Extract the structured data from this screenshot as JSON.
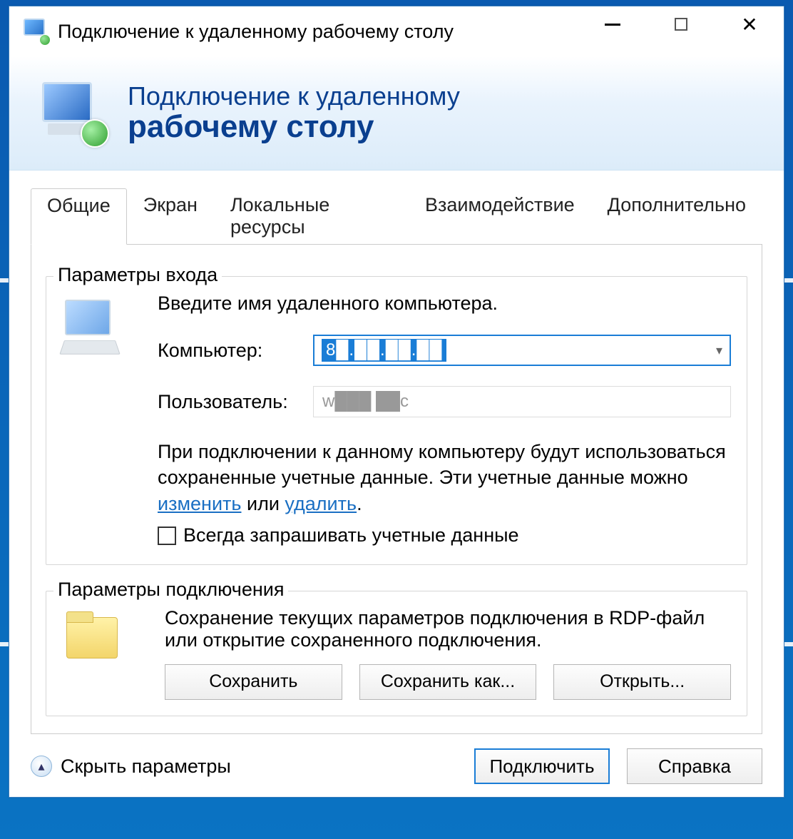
{
  "titlebar": {
    "title": "Подключение к удаленному рабочему столу"
  },
  "banner": {
    "line1": "Подключение к удаленному",
    "line2": "рабочему столу"
  },
  "tabs": [
    "Общие",
    "Экран",
    "Локальные ресурсы",
    "Взаимодействие",
    "Дополнительно"
  ],
  "login_group": {
    "legend": "Параметры входа",
    "prompt": "Введите имя удаленного компьютера.",
    "computer_label": "Компьютер:",
    "computer_value": "8█.██.██.██",
    "user_label": "Пользователь:",
    "user_value": "w███ ██c",
    "cred_text_1": "При подключении к данному компьютеру будут использоваться сохраненные учетные данные.  Эти учетные данные можно ",
    "link_change": "изменить",
    "cred_mid": " или ",
    "link_delete": "удалить",
    "cred_end": ".",
    "always_ask": "Всегда запрашивать учетные данные"
  },
  "conn_group": {
    "legend": "Параметры подключения",
    "desc": "Сохранение текущих параметров подключения в RDP-файл или открытие сохраненного подключения.",
    "save": "Сохранить",
    "save_as": "Сохранить как...",
    "open": "Открыть..."
  },
  "bottom": {
    "toggle": "Скрыть параметры",
    "connect": "Подключить",
    "help": "Справка"
  }
}
